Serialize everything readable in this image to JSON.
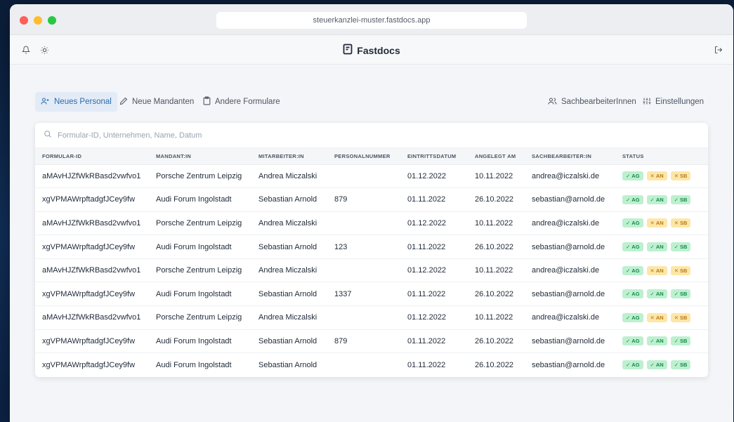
{
  "browser": {
    "url": "steuerkanzlei-muster.fastdocs.app"
  },
  "app": {
    "brand": "Fastdocs"
  },
  "icons": {
    "bell": "bell-icon",
    "theme": "sun-icon",
    "logout": "logout-icon",
    "logo": "fastdocs-logo-icon"
  },
  "tabs": [
    {
      "label": "Neues Personal",
      "icon": "user-plus-icon",
      "active": true
    },
    {
      "label": "Neue Mandanten",
      "icon": "pencil-icon",
      "active": false
    },
    {
      "label": "Andere Formulare",
      "icon": "clipboard-icon",
      "active": false
    }
  ],
  "actions": [
    {
      "label": "SachbearbeiterInnen",
      "icon": "users-icon"
    },
    {
      "label": "Einstellungen",
      "icon": "sliders-icon"
    }
  ],
  "search": {
    "placeholder": "Formular-ID, Unternehmen, Name, Datum",
    "value": ""
  },
  "table": {
    "columns": [
      "FORMULAR-ID",
      "MANDANT:IN",
      "MITARBEITER:IN",
      "PERSONALNUMMER",
      "EINTRITTSDATUM",
      "ANGELEGT AM",
      "SACHBEARBEITER:IN",
      "STATUS"
    ],
    "rows": [
      {
        "id": "aMAvHJZfWkRBasd2vwfvo1",
        "mandant": "Porsche Zentrum Leipzig",
        "mitarbeiter": "Andrea Miczalski",
        "personalnummer": "",
        "eintritt": "01.12.2022",
        "angelegt": "10.11.2022",
        "sachbearbeiter": "andrea@iczalski.de",
        "status": [
          {
            "label": "AG",
            "ok": true
          },
          {
            "label": "AN",
            "ok": false
          },
          {
            "label": "SB",
            "ok": false
          }
        ]
      },
      {
        "id": "xgVPMAWrpftadgfJCey9fw",
        "mandant": "Audi Forum Ingolstadt",
        "mitarbeiter": "Sebastian Arnold",
        "personalnummer": "879",
        "eintritt": "01.11.2022",
        "angelegt": "26.10.2022",
        "sachbearbeiter": "sebastian@arnold.de",
        "status": [
          {
            "label": "AG",
            "ok": true
          },
          {
            "label": "AN",
            "ok": true
          },
          {
            "label": "SB",
            "ok": true
          }
        ]
      },
      {
        "id": "aMAvHJZfWkRBasd2vwfvo1",
        "mandant": "Porsche Zentrum Leipzig",
        "mitarbeiter": "Andrea Miczalski",
        "personalnummer": "",
        "eintritt": "01.12.2022",
        "angelegt": "10.11.2022",
        "sachbearbeiter": "andrea@iczalski.de",
        "status": [
          {
            "label": "AG",
            "ok": true
          },
          {
            "label": "AN",
            "ok": false
          },
          {
            "label": "SB",
            "ok": false
          }
        ]
      },
      {
        "id": "xgVPMAWrpftadgfJCey9fw",
        "mandant": "Audi Forum Ingolstadt",
        "mitarbeiter": "Sebastian Arnold",
        "personalnummer": "123",
        "eintritt": "01.11.2022",
        "angelegt": "26.10.2022",
        "sachbearbeiter": "sebastian@arnold.de",
        "status": [
          {
            "label": "AG",
            "ok": true
          },
          {
            "label": "AN",
            "ok": true
          },
          {
            "label": "SB",
            "ok": true
          }
        ]
      },
      {
        "id": "aMAvHJZfWkRBasd2vwfvo1",
        "mandant": "Porsche Zentrum Leipzig",
        "mitarbeiter": "Andrea Miczalski",
        "personalnummer": "",
        "eintritt": "01.12.2022",
        "angelegt": "10.11.2022",
        "sachbearbeiter": "andrea@iczalski.de",
        "status": [
          {
            "label": "AG",
            "ok": true
          },
          {
            "label": "AN",
            "ok": false
          },
          {
            "label": "SB",
            "ok": false
          }
        ]
      },
      {
        "id": "xgVPMAWrpftadgfJCey9fw",
        "mandant": "Audi Forum Ingolstadt",
        "mitarbeiter": "Sebastian Arnold",
        "personalnummer": "1337",
        "eintritt": "01.11.2022",
        "angelegt": "26.10.2022",
        "sachbearbeiter": "sebastian@arnold.de",
        "status": [
          {
            "label": "AG",
            "ok": true
          },
          {
            "label": "AN",
            "ok": true
          },
          {
            "label": "SB",
            "ok": true
          }
        ]
      },
      {
        "id": "aMAvHJZfWkRBasd2vwfvo1",
        "mandant": "Porsche Zentrum Leipzig",
        "mitarbeiter": "Andrea Miczalski",
        "personalnummer": "",
        "eintritt": "01.12.2022",
        "angelegt": "10.11.2022",
        "sachbearbeiter": "andrea@iczalski.de",
        "status": [
          {
            "label": "AG",
            "ok": true
          },
          {
            "label": "AN",
            "ok": false
          },
          {
            "label": "SB",
            "ok": false
          }
        ]
      },
      {
        "id": "xgVPMAWrpftadgfJCey9fw",
        "mandant": "Audi Forum Ingolstadt",
        "mitarbeiter": "Sebastian Arnold",
        "personalnummer": "879",
        "eintritt": "01.11.2022",
        "angelegt": "26.10.2022",
        "sachbearbeiter": "sebastian@arnold.de",
        "status": [
          {
            "label": "AG",
            "ok": true
          },
          {
            "label": "AN",
            "ok": true
          },
          {
            "label": "SB",
            "ok": true
          }
        ]
      },
      {
        "id": "xgVPMAWrpftadgfJCey9fw",
        "mandant": "Audi Forum Ingolstadt",
        "mitarbeiter": "Sebastian Arnold",
        "personalnummer": "",
        "eintritt": "01.11.2022",
        "angelegt": "26.10.2022",
        "sachbearbeiter": "sebastian@arnold.de",
        "status": [
          {
            "label": "AG",
            "ok": true
          },
          {
            "label": "AN",
            "ok": true
          },
          {
            "label": "SB",
            "ok": true
          }
        ]
      }
    ]
  },
  "colors": {
    "accent": "#2b6cb0",
    "status_ok_bg": "#bdf0d0",
    "status_ok_fg": "#178a4a",
    "status_warn_bg": "#fde7a8",
    "status_warn_fg": "#b7791f"
  }
}
